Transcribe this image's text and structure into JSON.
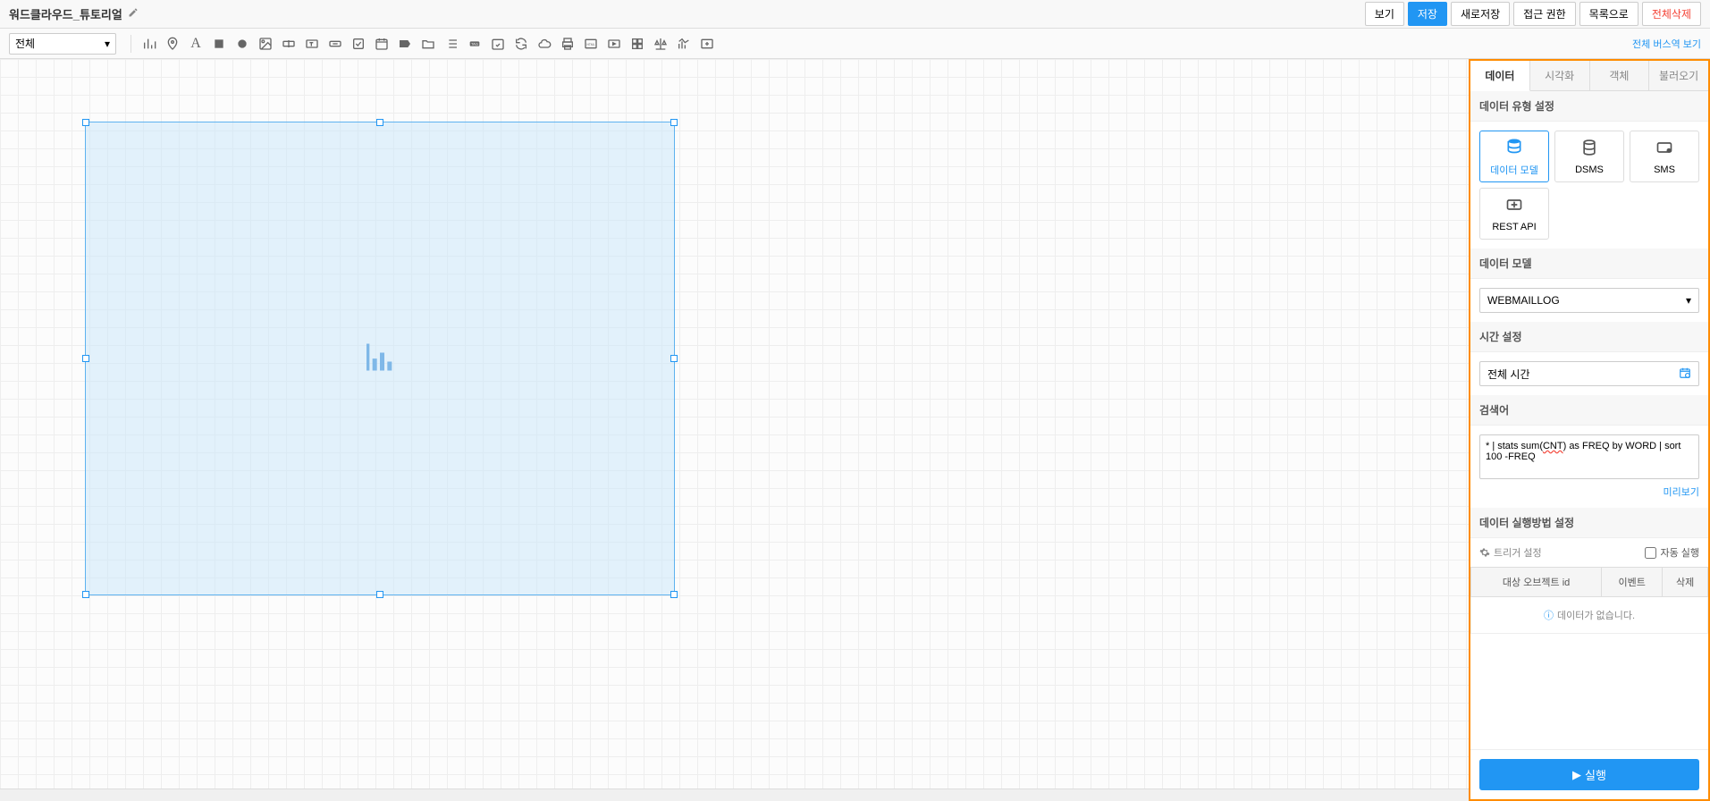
{
  "header": {
    "title": "워드클라우드_튜토리얼",
    "buttons": {
      "view": "보기",
      "save": "저장",
      "save_as": "새로저장",
      "access": "접근 권한",
      "list": "목록으로",
      "delete_all": "전체삭제"
    }
  },
  "toolbar": {
    "select_label": "전체",
    "version_link": "전체 버스역 보기"
  },
  "side": {
    "tabs": {
      "data": "데이터",
      "visual": "시각화",
      "object": "객체",
      "import": "불러오기"
    },
    "section_type": "데이터 유형 설정",
    "types": {
      "model": "데이터 모델",
      "dsms": "DSMS",
      "sms": "SMS",
      "rest": "REST API"
    },
    "section_model": "데이터 모델",
    "model_value": "WEBMAILLOG",
    "section_time": "시간 설정",
    "time_value": "전체 시간",
    "section_query": "검색어",
    "query_prefix": "* | stats sum(",
    "query_cnt": "CNT",
    "query_suffix": ") as FREQ by WORD | sort 100 -FREQ",
    "preview": "미리보기",
    "section_exec": "데이터 실행방법 설정",
    "trigger": "트리거 설정",
    "auto_exec": "자동 실행",
    "table": {
      "col1": "대상 오브젝트 id",
      "col2": "이벤트",
      "col3": "삭제",
      "empty": "데이터가 없습니다."
    },
    "run": "실행"
  }
}
